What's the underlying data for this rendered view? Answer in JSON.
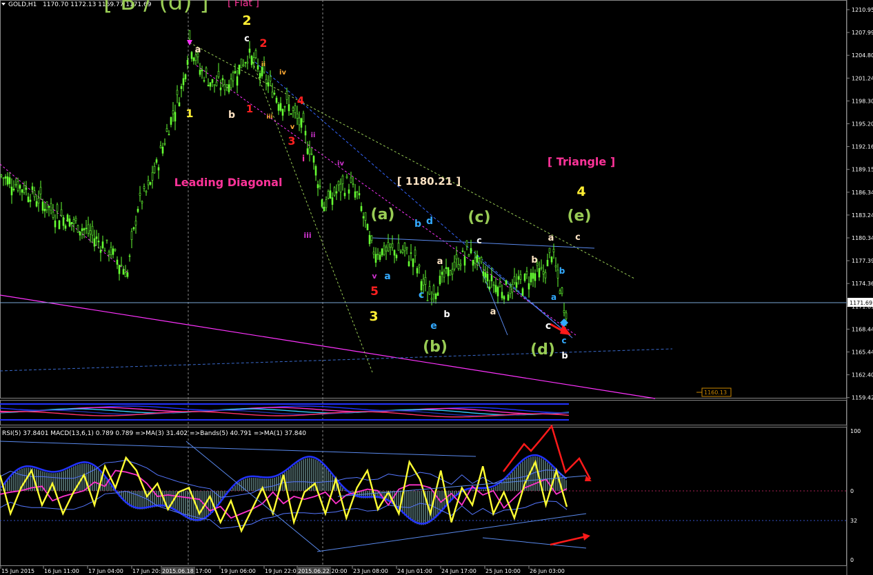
{
  "header": {
    "symbol": "GOLD,H1",
    "ohlc": "1170.70 1172.13 1169.77 1171.69",
    "top_label": "[ B / (d) ]",
    "flat_label": "[ Flat ]"
  },
  "colors": {
    "background": "#000000",
    "candle_bull": "#66ff33",
    "candle_bear": "#66ff33",
    "rsi_line": "#ffff33",
    "ma_line": "#ff33cc",
    "band_line": "#3366ff",
    "macd_hist": "#5a7a7a",
    "trend_magenta": "#ff33ff",
    "current_price_line": "#7aa7d6",
    "arrow_red": "#ff1a1a"
  },
  "chart_data": {
    "type": "line",
    "title": "GOLD,H1",
    "price_axis": {
      "ylim": [
        1158.5,
        1211.2
      ],
      "ticks": [
        "1210.95",
        "1207.99",
        "1204.80",
        "1201.24",
        "1198.30",
        "1195.20",
        "1192.16",
        "1189.15",
        "1186.34",
        "1183.24",
        "1180.34",
        "1177.39",
        "1174.36",
        "1171.69",
        "1168.44",
        "1165.44",
        "1162.40",
        "1159.42"
      ],
      "current_price": "1171.69",
      "marked_level": "1160.13"
    },
    "time_axis": {
      "ticks": [
        "15 Jun 2015",
        "16 Jun 11:00",
        "17 Jun 04:00",
        "17 Jun 20:00",
        "2015.06.18 17:00",
        "19 Jun 06:00",
        "19 Jun 22:00",
        "2015.06.22 20:00",
        "23 Jun 08:00",
        "24 Jun 01:00",
        "24 Jun 17:00",
        "25 Jun 10:00",
        "26 Jun 03:00"
      ]
    },
    "price_series": {
      "name": "",
      "x": [
        0,
        40,
        80,
        120,
        160,
        185,
        200,
        215,
        230,
        250,
        265,
        275,
        290,
        310,
        330,
        345,
        360,
        375,
        390,
        405,
        420,
        440,
        455,
        470,
        490,
        505,
        520,
        540,
        560,
        580,
        600,
        620,
        640,
        660,
        680,
        695,
        710,
        725,
        740,
        760,
        775,
        790,
        800,
        812,
        820
      ],
      "y": [
        1188,
        1186,
        1183,
        1181,
        1178,
        1175,
        1184,
        1186,
        1190,
        1196,
        1200,
        1206,
        1202,
        1200,
        1200,
        1202,
        1204,
        1202,
        1200,
        1198,
        1197,
        1194,
        1190,
        1184,
        1186,
        1187,
        1185,
        1178,
        1178,
        1178,
        1177,
        1172,
        1174,
        1176,
        1178,
        1176,
        1174,
        1173,
        1173,
        1174,
        1175,
        1175,
        1178,
        1173,
        1170
      ]
    },
    "oscillator": {
      "legend": "RSI(5) 37.8401  MACD(13,6,1) 0.789 0.789  =>MA(3) 31.402  =>Bands(5) 40.791  =>MA(1) 37.840",
      "ylim": [
        -30,
        130
      ],
      "ticks": [
        "100",
        "0",
        "32",
        "0"
      ],
      "rsi": [
        75,
        30,
        60,
        80,
        40,
        65,
        30,
        55,
        75,
        40,
        85,
        60,
        95,
        80,
        50,
        65,
        35,
        55,
        60,
        30,
        50,
        20,
        45,
        10,
        35,
        60,
        30,
        75,
        20,
        55,
        65,
        30,
        70,
        25,
        60,
        80,
        35,
        55,
        30,
        90,
        70,
        30,
        80,
        20,
        60,
        40,
        85,
        30,
        55,
        25,
        65,
        90,
        40,
        80,
        38
      ]
    },
    "wave_labels": [
      {
        "t": "2",
        "c": "#ffee33",
        "x": 358,
        "y": 36,
        "s": 19
      },
      {
        "t": "c",
        "c": "#ffffff",
        "x": 358,
        "y": 60,
        "s": 13
      },
      {
        "t": "2",
        "c": "#ff2020",
        "x": 382,
        "y": 68,
        "s": 16
      },
      {
        "t": "a",
        "c": "#ffe4c4",
        "x": 287,
        "y": 76,
        "s": 13
      },
      {
        "t": "1",
        "c": "#ffee33",
        "x": 275,
        "y": 170,
        "s": 16
      },
      {
        "t": "b",
        "c": "#ffe4c4",
        "x": 336,
        "y": 171,
        "s": 14
      },
      {
        "t": "1",
        "c": "#ff2020",
        "x": 362,
        "y": 163,
        "s": 15
      },
      {
        "t": "4",
        "c": "#ff2020",
        "x": 436,
        "y": 151,
        "s": 15
      },
      {
        "t": "3",
        "c": "#ff2020",
        "x": 423,
        "y": 210,
        "s": 16
      },
      {
        "t": "i",
        "c": "#ff33aa",
        "x": 440,
        "y": 234,
        "s": 12
      },
      {
        "t": "iii",
        "c": "#cc33cc",
        "x": 446,
        "y": 345,
        "s": 11
      },
      {
        "t": "iv",
        "c": "#cc33cc",
        "x": 494,
        "y": 240,
        "s": 10
      },
      {
        "t": "ii",
        "c": "#cc33cc",
        "x": 454,
        "y": 199,
        "s": 10
      },
      {
        "t": "v",
        "c": "#ffaa33",
        "x": 424,
        "y": 187,
        "s": 10
      },
      {
        "t": "iv",
        "c": "#ffaa33",
        "x": 410,
        "y": 108,
        "s": 10
      },
      {
        "t": "ii",
        "c": "#ffaa33",
        "x": 382,
        "y": 96,
        "s": 9
      },
      {
        "t": "iii",
        "c": "#ffaa33",
        "x": 391,
        "y": 172,
        "s": 9
      },
      {
        "t": "Leading Diagonal",
        "c": "#ff3399",
        "x": 331,
        "y": 270,
        "s": 16
      },
      {
        "t": "[ 1180.21 ]",
        "c": "#ffe4c4",
        "x": 622,
        "y": 268,
        "s": 15
      },
      {
        "t": "[ Triangle ]",
        "c": "#ff3399",
        "x": 843,
        "y": 240,
        "s": 16
      },
      {
        "t": "4",
        "c": "#ffee33",
        "x": 843,
        "y": 284,
        "s": 19
      },
      {
        "t": "(e)",
        "c": "#99cc55",
        "x": 840,
        "y": 320,
        "s": 22
      },
      {
        "t": "c",
        "c": "#ffe4c4",
        "x": 838,
        "y": 348,
        "s": 13
      },
      {
        "t": "a",
        "c": "#ffe4c4",
        "x": 799,
        "y": 349,
        "s": 13
      },
      {
        "t": "b",
        "c": "#ffe4c4",
        "x": 775,
        "y": 381,
        "s": 13
      },
      {
        "t": "b",
        "c": "#33aaff",
        "x": 815,
        "y": 397,
        "s": 12
      },
      {
        "t": "a",
        "c": "#33aaff",
        "x": 803,
        "y": 435,
        "s": 12
      },
      {
        "t": "c",
        "c": "#ffffff",
        "x": 795,
        "y": 477,
        "s": 14
      },
      {
        "t": "c",
        "c": "#33aaff",
        "x": 818,
        "y": 498,
        "s": 12
      },
      {
        "t": "(d)",
        "c": "#99cc55",
        "x": 787,
        "y": 514,
        "s": 22
      },
      {
        "t": "b",
        "c": "#ffffff",
        "x": 819,
        "y": 520,
        "s": 13
      },
      {
        "t": "(a)",
        "c": "#99cc55",
        "x": 555,
        "y": 318,
        "s": 22
      },
      {
        "t": "a",
        "c": "#33aaff",
        "x": 562,
        "y": 405,
        "s": 14
      },
      {
        "t": "v",
        "c": "#cc33cc",
        "x": 543,
        "y": 404,
        "s": 11
      },
      {
        "t": "5",
        "c": "#ff2020",
        "x": 543,
        "y": 428,
        "s": 17
      },
      {
        "t": "3",
        "c": "#ffee33",
        "x": 542,
        "y": 465,
        "s": 19
      },
      {
        "t": "b",
        "c": "#33aaff",
        "x": 606,
        "y": 329,
        "s": 14
      },
      {
        "t": "d",
        "c": "#33aaff",
        "x": 623,
        "y": 325,
        "s": 14
      },
      {
        "t": "c",
        "c": "#33aaff",
        "x": 611,
        "y": 432,
        "s": 14
      },
      {
        "t": "e",
        "c": "#33aaff",
        "x": 629,
        "y": 477,
        "s": 14
      },
      {
        "t": "a",
        "c": "#ffe4c4",
        "x": 638,
        "y": 383,
        "s": 13
      },
      {
        "t": "b",
        "c": "#ffffff",
        "x": 648,
        "y": 460,
        "s": 13
      },
      {
        "t": "(b)",
        "c": "#99cc55",
        "x": 631,
        "y": 510,
        "s": 22
      },
      {
        "t": "(c)",
        "c": "#99cc55",
        "x": 695,
        "y": 322,
        "s": 22
      },
      {
        "t": "c",
        "c": "#ffffff",
        "x": 695,
        "y": 353,
        "s": 13
      },
      {
        "t": "a",
        "c": "#ffe4c4",
        "x": 715,
        "y": 456,
        "s": 13
      }
    ]
  }
}
